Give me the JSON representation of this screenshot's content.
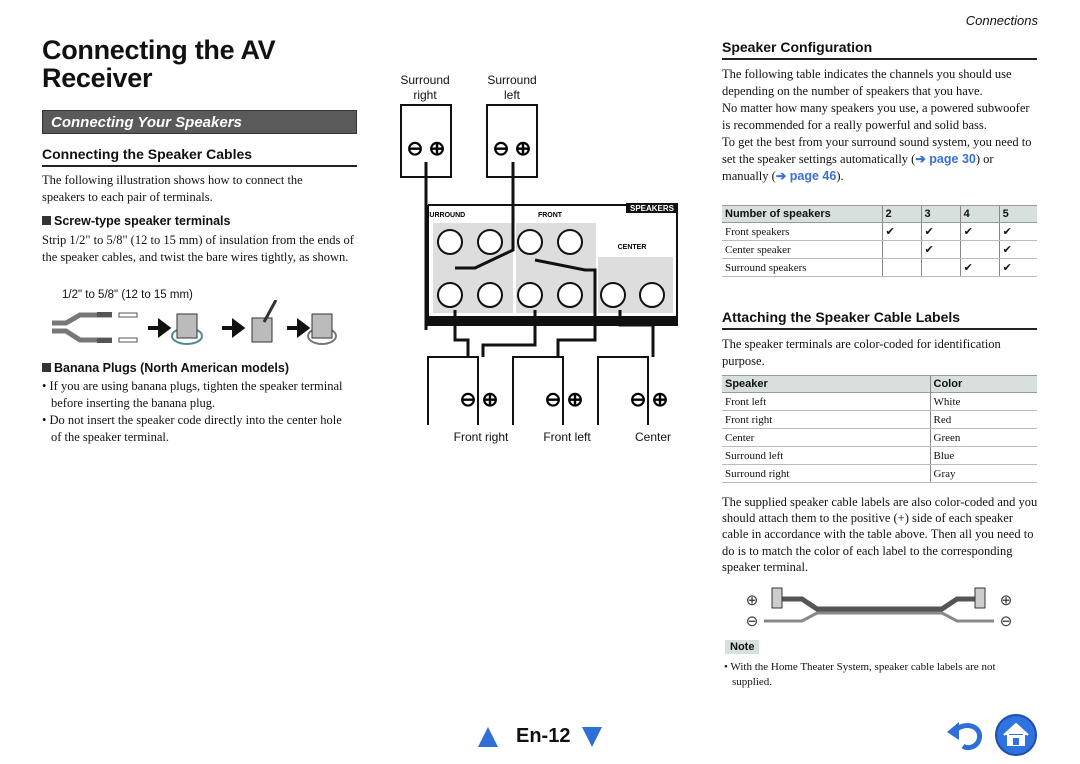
{
  "header": {
    "section": "Connections"
  },
  "left": {
    "title": "Connecting the AV Receiver",
    "banner": "Connecting Your Speakers",
    "cables_heading": "Connecting the Speaker Cables",
    "cables_intro": "The following illustration shows how to connect the speakers to each pair of terminals.",
    "screw_heading": "Screw-type speaker terminals",
    "screw_text": "Strip 1/2\" to 5/8\" (12 to 15 mm) of insulation from the ends of the speaker cables, and twist the bare wires tightly, as shown.",
    "strip_label": "1/2\" to 5/8\" (12 to 15 mm)",
    "banana_heading": "Banana Plugs (North American models)",
    "banana_items": [
      "If you are using banana plugs, tighten the speaker terminal before inserting the banana plug.",
      "Do not insert the speaker code directly into the center hole of the speaker terminal."
    ]
  },
  "diagram": {
    "surround_right": [
      "Surround",
      "right"
    ],
    "surround_left": [
      "Surround",
      "left"
    ],
    "panel_title": "SPEAKERS",
    "group_surround": "SURROUND",
    "group_front": "FRONT",
    "group_center": "CENTER",
    "front_right": "Front right",
    "front_left": "Front left",
    "center": "Center"
  },
  "right": {
    "config_heading": "Speaker Configuration",
    "config_p1": "The following table indicates the channels you should use depending on the number of speakers that you have.",
    "config_p2": "No matter how many speakers you use, a powered subwoofer is recommended for a really powerful and solid bass.",
    "config_p3_a": "To get the best from your surround sound system, you need to set the speaker settings automatically (",
    "config_link1": "➔ page 30",
    "config_p3_b": ") or manually (",
    "config_link2": "➔ page 46",
    "config_p3_c": ").",
    "table1": {
      "headers": [
        "Number of speakers",
        "2",
        "3",
        "4",
        "5"
      ],
      "rows": [
        [
          "Front speakers",
          "✔",
          "✔",
          "✔",
          "✔"
        ],
        [
          "Center speaker",
          "",
          "✔",
          "",
          "✔"
        ],
        [
          "Surround speakers",
          "",
          "",
          "✔",
          "✔"
        ]
      ]
    },
    "labels_heading": "Attaching the Speaker Cable Labels",
    "labels_p1": "The speaker terminals are color-coded for identification purpose.",
    "table2": {
      "headers": [
        "Speaker",
        "Color"
      ],
      "rows": [
        [
          "Front left",
          "White"
        ],
        [
          "Front right",
          "Red"
        ],
        [
          "Center",
          "Green"
        ],
        [
          "Surround left",
          "Blue"
        ],
        [
          "Surround right",
          "Gray"
        ]
      ]
    },
    "labels_p2": "The supplied speaker cable labels are also color-coded and you should attach them to the positive (+) side of each speaker cable in accordance with the table above. Then all you need to do is to match the color of each label to the corresponding speaker terminal.",
    "note_label": "Note",
    "note_text": "With the Home Theater System, speaker cable labels are not supplied."
  },
  "footer": {
    "page": "En-12",
    "accent": "#2f6fd6"
  }
}
